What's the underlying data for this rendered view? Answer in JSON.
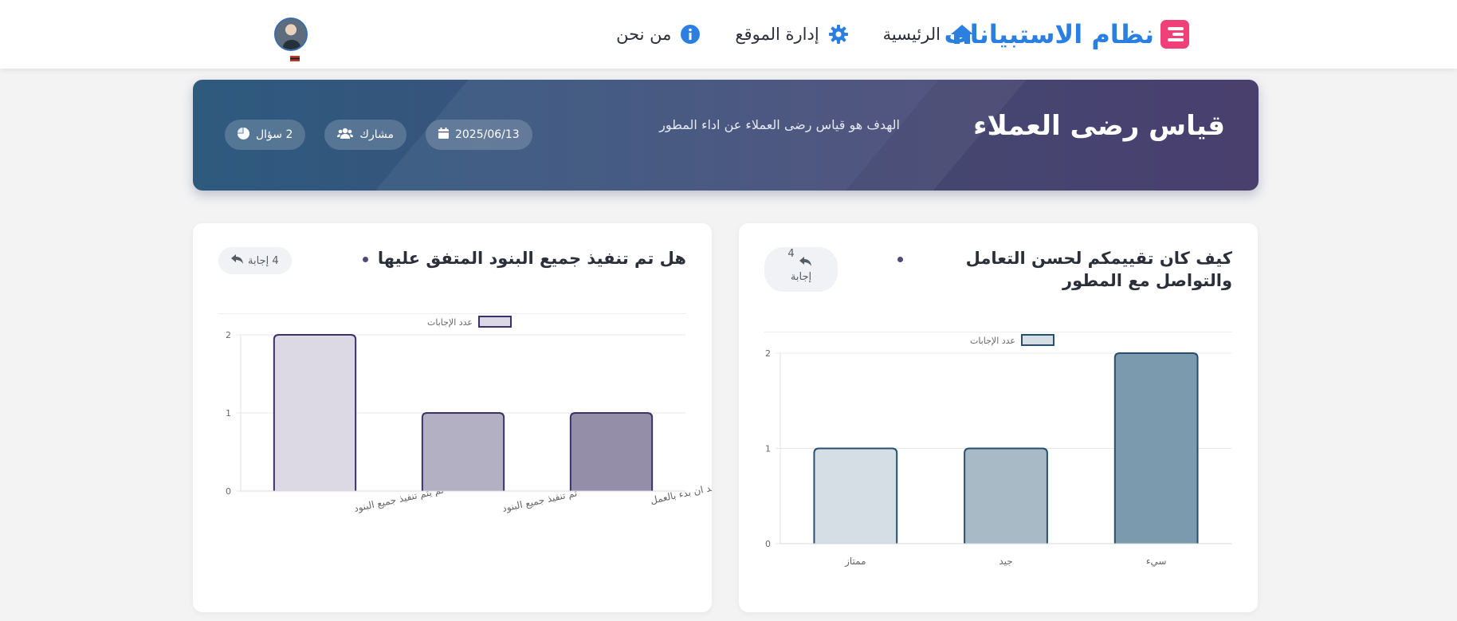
{
  "navbar": {
    "brand": "نظام الاستبيانات",
    "items": [
      {
        "label": "الرئيسية",
        "icon": "home-icon"
      },
      {
        "label": "إدارة الموقع",
        "icon": "gear-icon"
      },
      {
        "label": "من نحن",
        "icon": "info-icon"
      }
    ],
    "colors": {
      "brand": "#2a7fe0",
      "logo": "#f0407a"
    }
  },
  "survey": {
    "title": "قياس رضى العملاء",
    "description": "الهدف هو قياس رضى العملاء عن اداء المطور",
    "date": "2025/06/13",
    "participants_label": "مشارك",
    "questions_label": "2 سؤال"
  },
  "questions": [
    {
      "title": "كيف كان تقييمكم لحسن التعامل والتواصل مع المطور",
      "answers_count": "4",
      "answers_label": "إجابة"
    },
    {
      "title": "هل تم تنفيذ جميع البنود المتفق عليها",
      "answers_badge": "4 إجابة"
    }
  ],
  "chart_data": [
    {
      "type": "bar",
      "categories": [
        "ممتاز",
        "جيد",
        "سيء"
      ],
      "series": [
        {
          "name": "عدد الإجابات",
          "values": [
            1,
            1,
            2
          ]
        }
      ],
      "ylim": [
        0,
        2
      ],
      "yticks": [
        "0",
        "1",
        "2"
      ],
      "grid": true,
      "legend": "top-center",
      "colors": [
        "#d5dde5",
        "#a9bac7",
        "#7b9aae"
      ],
      "border_color": "#26506e"
    },
    {
      "type": "bar",
      "categories": [
        "لم يتم تنفيذ جميع البنود",
        "تم تنفيذ جميع البنود",
        "طلب مني المطور تعديل بعض البنود بعد ان بدء بالعمل"
      ],
      "series": [
        {
          "name": "عدد الإجابات",
          "values": [
            2,
            1,
            1
          ]
        }
      ],
      "ylim": [
        0,
        2
      ],
      "yticks": [
        "0",
        "1",
        "2"
      ],
      "grid": true,
      "legend": "top-center",
      "colors": [
        "#dcd9e4",
        "#b4b0c4",
        "#958ea9"
      ],
      "border_color": "#3a3268"
    }
  ]
}
